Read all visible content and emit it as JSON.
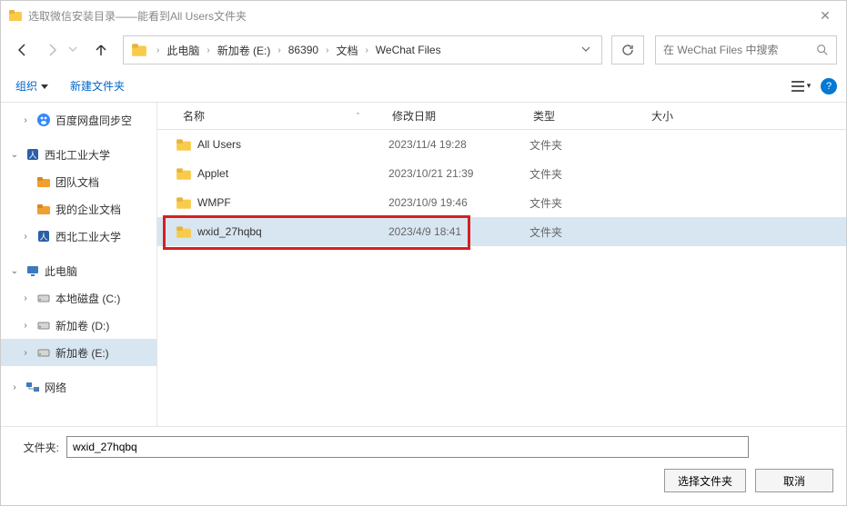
{
  "window": {
    "title": "选取微信安装目录——能看到All Users文件夹",
    "close_x": "✕"
  },
  "nav": {
    "breadcrumb": [
      "此电脑",
      "新加卷 (E:)",
      "86390",
      "文档",
      "WeChat Files"
    ]
  },
  "search": {
    "placeholder": "在 WeChat Files 中搜索"
  },
  "toolbar": {
    "organize": "组织",
    "new_folder": "新建文件夹"
  },
  "columns": {
    "name": "名称",
    "date": "修改日期",
    "type": "类型",
    "size": "大小"
  },
  "tree": [
    {
      "expander": "›",
      "icon": "baidu",
      "label": "百度网盘同步空",
      "indent": 1
    },
    {
      "expander": "⌄",
      "icon": "nwpu",
      "label": "西北工业大学",
      "indent": 0
    },
    {
      "expander": "",
      "icon": "folder-y",
      "label": "团队文档",
      "indent": 1
    },
    {
      "expander": "",
      "icon": "folder-y",
      "label": "我的企业文档",
      "indent": 1
    },
    {
      "expander": "›",
      "icon": "nwpu",
      "label": "西北工业大学",
      "indent": 1
    },
    {
      "expander": "⌄",
      "icon": "pc",
      "label": "此电脑",
      "indent": 0
    },
    {
      "expander": "›",
      "icon": "disk",
      "label": "本地磁盘 (C:)",
      "indent": 1
    },
    {
      "expander": "›",
      "icon": "disk",
      "label": "新加卷 (D:)",
      "indent": 1
    },
    {
      "expander": "›",
      "icon": "disk",
      "label": "新加卷 (E:)",
      "indent": 1,
      "selected": true
    },
    {
      "expander": "›",
      "icon": "net",
      "label": "网络",
      "indent": 0
    }
  ],
  "files": [
    {
      "name": "All Users",
      "date": "2023/11/4 19:28",
      "type": "文件夹",
      "size": ""
    },
    {
      "name": "Applet",
      "date": "2023/10/21 21:39",
      "type": "文件夹",
      "size": ""
    },
    {
      "name": "WMPF",
      "date": "2023/10/9 19:46",
      "type": "文件夹",
      "size": ""
    },
    {
      "name": "wxid_27hqbq",
      "date": "2023/4/9 18:41",
      "type": "文件夹",
      "size": "",
      "selected": true,
      "highlighted": true
    }
  ],
  "bottom": {
    "folder_label": "文件夹:",
    "folder_value": "wxid_27hqbq",
    "select_btn": "选择文件夹",
    "cancel_btn": "取消"
  }
}
